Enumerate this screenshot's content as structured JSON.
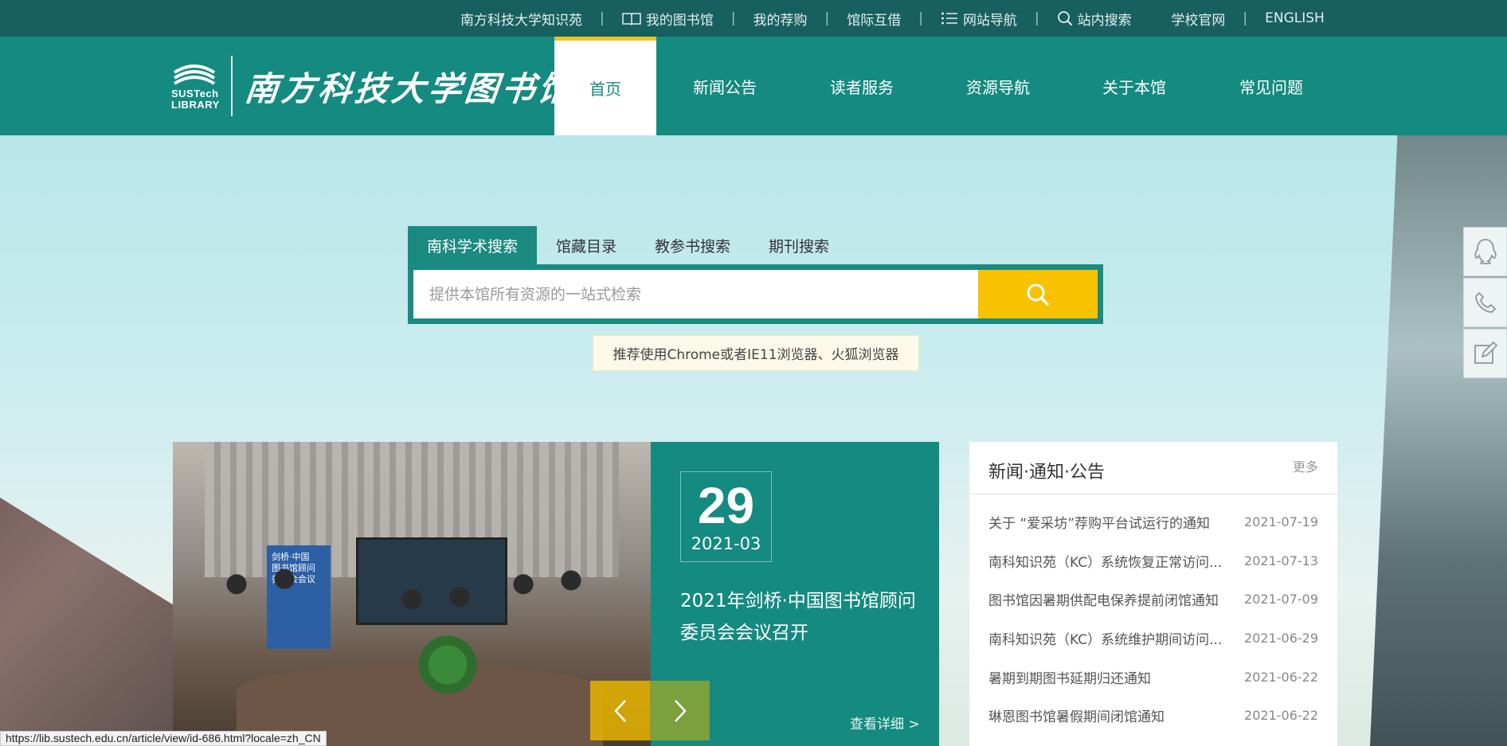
{
  "topbar": {
    "links": [
      {
        "label": "南方科技大学知识苑",
        "icon": ""
      },
      {
        "label": "我的图书馆",
        "icon": "book-icon"
      },
      {
        "label": "我的荐购",
        "icon": ""
      },
      {
        "label": "馆际互借",
        "icon": ""
      },
      {
        "label": "网站导航",
        "icon": "list-icon"
      },
      {
        "label": "站内搜索",
        "icon": "search-icon"
      },
      {
        "label": "学校官网",
        "icon": ""
      },
      {
        "label": "ENGLISH",
        "icon": ""
      }
    ],
    "separator": "|"
  },
  "header": {
    "logo_mark": "SUSTech\nLIBRARY",
    "logo_name": "南方科技大学图书馆",
    "nav": [
      "首页",
      "新闻公告",
      "读者服务",
      "资源导航",
      "关于本馆",
      "常见问题"
    ],
    "active_nav": "首页"
  },
  "search": {
    "tabs": [
      "南科学术搜索",
      "馆藏目录",
      "教参书搜索",
      "期刊搜索"
    ],
    "active_tab": "南科学术搜索",
    "placeholder": "提供本馆所有资源的一站式检索",
    "value": "",
    "button_icon": "search-icon",
    "tip": "推荐使用Chrome或者IE11浏览器、火狐浏览器"
  },
  "side_buttons": [
    "qq-icon",
    "phone-icon",
    "edit-icon"
  ],
  "slide": {
    "day": "29",
    "year_month": "2021-03",
    "title": "2021年剑桥·中国图书馆顾问委员会会议召开",
    "more": "查看详细 >",
    "poster_text": "剑桥·中国\n图书馆顾问\n委员会会议"
  },
  "news": {
    "title": "新闻·通知·公告",
    "more": "更多",
    "items": [
      {
        "title": "关于 “爱采坊”荐购平台试运行的通知",
        "date": "2021-07-19"
      },
      {
        "title": "南科知识苑（KC）系统恢复正常访问...",
        "date": "2021-07-13"
      },
      {
        "title": "图书馆因暑期供配电保养提前闭馆通知",
        "date": "2021-07-09"
      },
      {
        "title": "南科知识苑（KC）系统维护期间访问...",
        "date": "2021-06-29"
      },
      {
        "title": "暑期到期图书延期归还通知",
        "date": "2021-06-22"
      },
      {
        "title": "琳恩图书馆暑假期间闭馆通知",
        "date": "2021-06-22"
      }
    ]
  },
  "status_url": "https://lib.sustech.edu.cn/article/view/id-686.html?locale=zh_CN",
  "colors": {
    "topbar": "#17605f",
    "header": "#148a80",
    "accent": "#f2c21b",
    "search_button": "#f8c200"
  }
}
